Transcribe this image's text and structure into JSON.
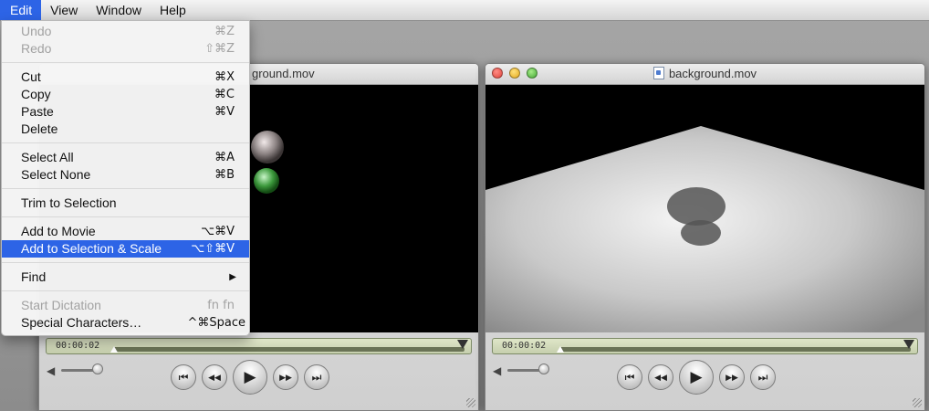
{
  "menubar": {
    "items": [
      "Edit",
      "View",
      "Window",
      "Help"
    ]
  },
  "edit_menu": {
    "undo": {
      "label": "Undo",
      "shortcut": "⌘Z"
    },
    "redo": {
      "label": "Redo",
      "shortcut": "⇧⌘Z"
    },
    "cut": {
      "label": "Cut",
      "shortcut": "⌘X"
    },
    "copy": {
      "label": "Copy",
      "shortcut": "⌘C"
    },
    "paste": {
      "label": "Paste",
      "shortcut": "⌘V"
    },
    "delete": {
      "label": "Delete"
    },
    "select_all": {
      "label": "Select All",
      "shortcut": "⌘A"
    },
    "select_none": {
      "label": "Select None",
      "shortcut": "⌘B"
    },
    "trim": {
      "label": "Trim to Selection"
    },
    "add_to_movie": {
      "label": "Add to Movie",
      "shortcut": "⌥⌘V"
    },
    "add_to_selection": {
      "label": "Add to Selection & Scale",
      "shortcut": "⌥⇧⌘V"
    },
    "find": {
      "label": "Find",
      "submenu_glyph": "▶"
    },
    "dictation": {
      "label": "Start Dictation",
      "shortcut": "fn fn"
    },
    "special": {
      "label": "Special Characters…",
      "shortcut": "^⌘Space"
    }
  },
  "left_window": {
    "title": "ground.mov",
    "timecode": "00:00:02"
  },
  "right_window": {
    "title": "background.mov",
    "timecode": "00:00:02"
  },
  "controls": {
    "prev_glyph": "⏮",
    "rewind_glyph": "◀◀",
    "play_glyph": "▶",
    "forward_glyph": "▶▶",
    "next_glyph": "⏭",
    "volume_glyph": "◀"
  },
  "colors": {
    "highlight": "#2d64e6",
    "video_bg": "#000000"
  }
}
